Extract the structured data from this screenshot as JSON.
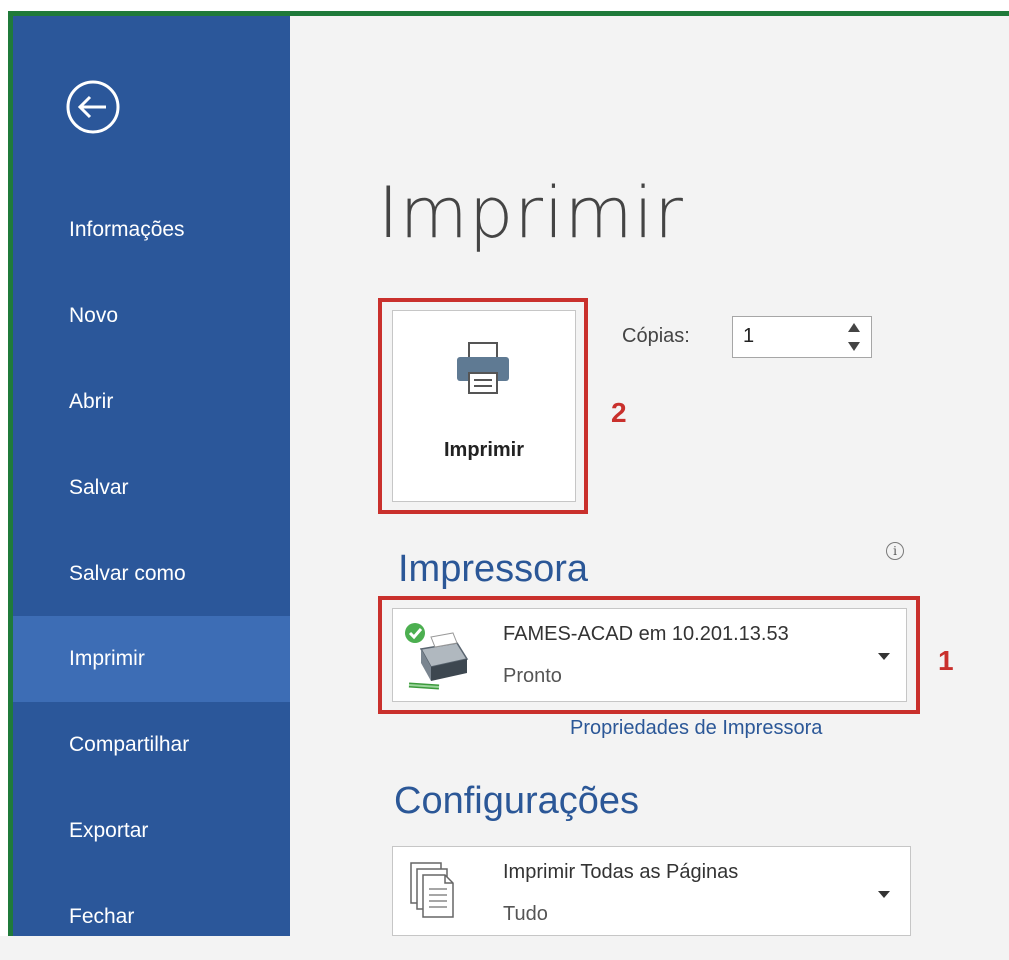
{
  "sidebar": {
    "items": [
      {
        "label": "Informações"
      },
      {
        "label": "Novo"
      },
      {
        "label": "Abrir"
      },
      {
        "label": "Salvar"
      },
      {
        "label": "Salvar como"
      },
      {
        "label": "Imprimir"
      },
      {
        "label": "Compartilhar"
      },
      {
        "label": "Exportar"
      },
      {
        "label": "Fechar"
      }
    ],
    "active_item": "Imprimir"
  },
  "main": {
    "title": "Imprimir",
    "print_button": {
      "label": "Imprimir"
    },
    "copies": {
      "label": "Cópias:",
      "value": "1"
    },
    "annotations": {
      "print_button": "2",
      "printer": "1"
    },
    "printer_section": {
      "title": "Impressora",
      "printer_name": "FAMES-ACAD em 10.201.13.53",
      "status": "Pronto",
      "properties_link": "Propriedades de Impressora"
    },
    "settings_section": {
      "title": "Configurações",
      "pages_option": "Imprimir Todas as Páginas",
      "pages_sub": "Tudo"
    }
  },
  "colors": {
    "sidebar_bg": "#2b579a",
    "sidebar_active": "#3d6db5",
    "accent_blue": "#2b5797",
    "annotation_red": "#c9302c",
    "frame_green": "#1f7a3a"
  },
  "icons": {
    "back": "back-arrow-icon",
    "printer": "printer-icon",
    "printer_device": "printer-device-icon",
    "ready_check": "check-icon",
    "pages": "pages-icon",
    "info": "info-icon"
  }
}
